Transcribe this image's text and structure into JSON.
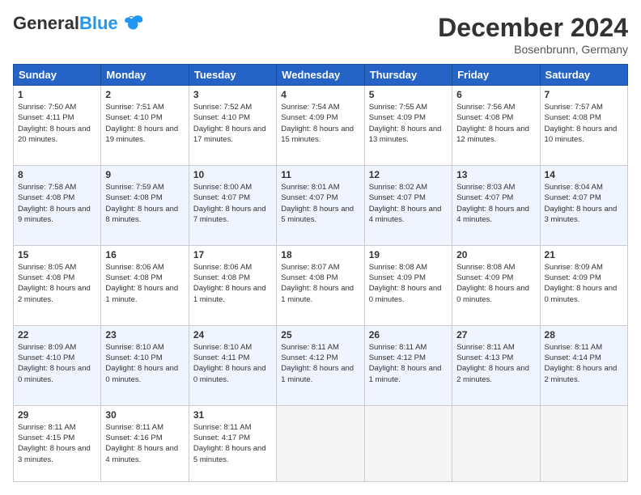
{
  "header": {
    "logo_general": "General",
    "logo_blue": "Blue",
    "month_title": "December 2024",
    "location": "Bosenbrunn, Germany"
  },
  "days_of_week": [
    "Sunday",
    "Monday",
    "Tuesday",
    "Wednesday",
    "Thursday",
    "Friday",
    "Saturday"
  ],
  "weeks": [
    [
      {
        "day": "1",
        "sunrise": "7:50 AM",
        "sunset": "4:11 PM",
        "daylight": "8 hours and 20 minutes."
      },
      {
        "day": "2",
        "sunrise": "7:51 AM",
        "sunset": "4:10 PM",
        "daylight": "8 hours and 19 minutes."
      },
      {
        "day": "3",
        "sunrise": "7:52 AM",
        "sunset": "4:10 PM",
        "daylight": "8 hours and 17 minutes."
      },
      {
        "day": "4",
        "sunrise": "7:54 AM",
        "sunset": "4:09 PM",
        "daylight": "8 hours and 15 minutes."
      },
      {
        "day": "5",
        "sunrise": "7:55 AM",
        "sunset": "4:09 PM",
        "daylight": "8 hours and 13 minutes."
      },
      {
        "day": "6",
        "sunrise": "7:56 AM",
        "sunset": "4:08 PM",
        "daylight": "8 hours and 12 minutes."
      },
      {
        "day": "7",
        "sunrise": "7:57 AM",
        "sunset": "4:08 PM",
        "daylight": "8 hours and 10 minutes."
      }
    ],
    [
      {
        "day": "8",
        "sunrise": "7:58 AM",
        "sunset": "4:08 PM",
        "daylight": "8 hours and 9 minutes."
      },
      {
        "day": "9",
        "sunrise": "7:59 AM",
        "sunset": "4:08 PM",
        "daylight": "8 hours and 8 minutes."
      },
      {
        "day": "10",
        "sunrise": "8:00 AM",
        "sunset": "4:07 PM",
        "daylight": "8 hours and 7 minutes."
      },
      {
        "day": "11",
        "sunrise": "8:01 AM",
        "sunset": "4:07 PM",
        "daylight": "8 hours and 5 minutes."
      },
      {
        "day": "12",
        "sunrise": "8:02 AM",
        "sunset": "4:07 PM",
        "daylight": "8 hours and 4 minutes."
      },
      {
        "day": "13",
        "sunrise": "8:03 AM",
        "sunset": "4:07 PM",
        "daylight": "8 hours and 4 minutes."
      },
      {
        "day": "14",
        "sunrise": "8:04 AM",
        "sunset": "4:07 PM",
        "daylight": "8 hours and 3 minutes."
      }
    ],
    [
      {
        "day": "15",
        "sunrise": "8:05 AM",
        "sunset": "4:08 PM",
        "daylight": "8 hours and 2 minutes."
      },
      {
        "day": "16",
        "sunrise": "8:06 AM",
        "sunset": "4:08 PM",
        "daylight": "8 hours and 1 minute."
      },
      {
        "day": "17",
        "sunrise": "8:06 AM",
        "sunset": "4:08 PM",
        "daylight": "8 hours and 1 minute."
      },
      {
        "day": "18",
        "sunrise": "8:07 AM",
        "sunset": "4:08 PM",
        "daylight": "8 hours and 1 minute."
      },
      {
        "day": "19",
        "sunrise": "8:08 AM",
        "sunset": "4:09 PM",
        "daylight": "8 hours and 0 minutes."
      },
      {
        "day": "20",
        "sunrise": "8:08 AM",
        "sunset": "4:09 PM",
        "daylight": "8 hours and 0 minutes."
      },
      {
        "day": "21",
        "sunrise": "8:09 AM",
        "sunset": "4:09 PM",
        "daylight": "8 hours and 0 minutes."
      }
    ],
    [
      {
        "day": "22",
        "sunrise": "8:09 AM",
        "sunset": "4:10 PM",
        "daylight": "8 hours and 0 minutes."
      },
      {
        "day": "23",
        "sunrise": "8:10 AM",
        "sunset": "4:10 PM",
        "daylight": "8 hours and 0 minutes."
      },
      {
        "day": "24",
        "sunrise": "8:10 AM",
        "sunset": "4:11 PM",
        "daylight": "8 hours and 0 minutes."
      },
      {
        "day": "25",
        "sunrise": "8:11 AM",
        "sunset": "4:12 PM",
        "daylight": "8 hours and 1 minute."
      },
      {
        "day": "26",
        "sunrise": "8:11 AM",
        "sunset": "4:12 PM",
        "daylight": "8 hours and 1 minute."
      },
      {
        "day": "27",
        "sunrise": "8:11 AM",
        "sunset": "4:13 PM",
        "daylight": "8 hours and 2 minutes."
      },
      {
        "day": "28",
        "sunrise": "8:11 AM",
        "sunset": "4:14 PM",
        "daylight": "8 hours and 2 minutes."
      }
    ],
    [
      {
        "day": "29",
        "sunrise": "8:11 AM",
        "sunset": "4:15 PM",
        "daylight": "8 hours and 3 minutes."
      },
      {
        "day": "30",
        "sunrise": "8:11 AM",
        "sunset": "4:16 PM",
        "daylight": "8 hours and 4 minutes."
      },
      {
        "day": "31",
        "sunrise": "8:11 AM",
        "sunset": "4:17 PM",
        "daylight": "8 hours and 5 minutes."
      },
      null,
      null,
      null,
      null
    ]
  ]
}
